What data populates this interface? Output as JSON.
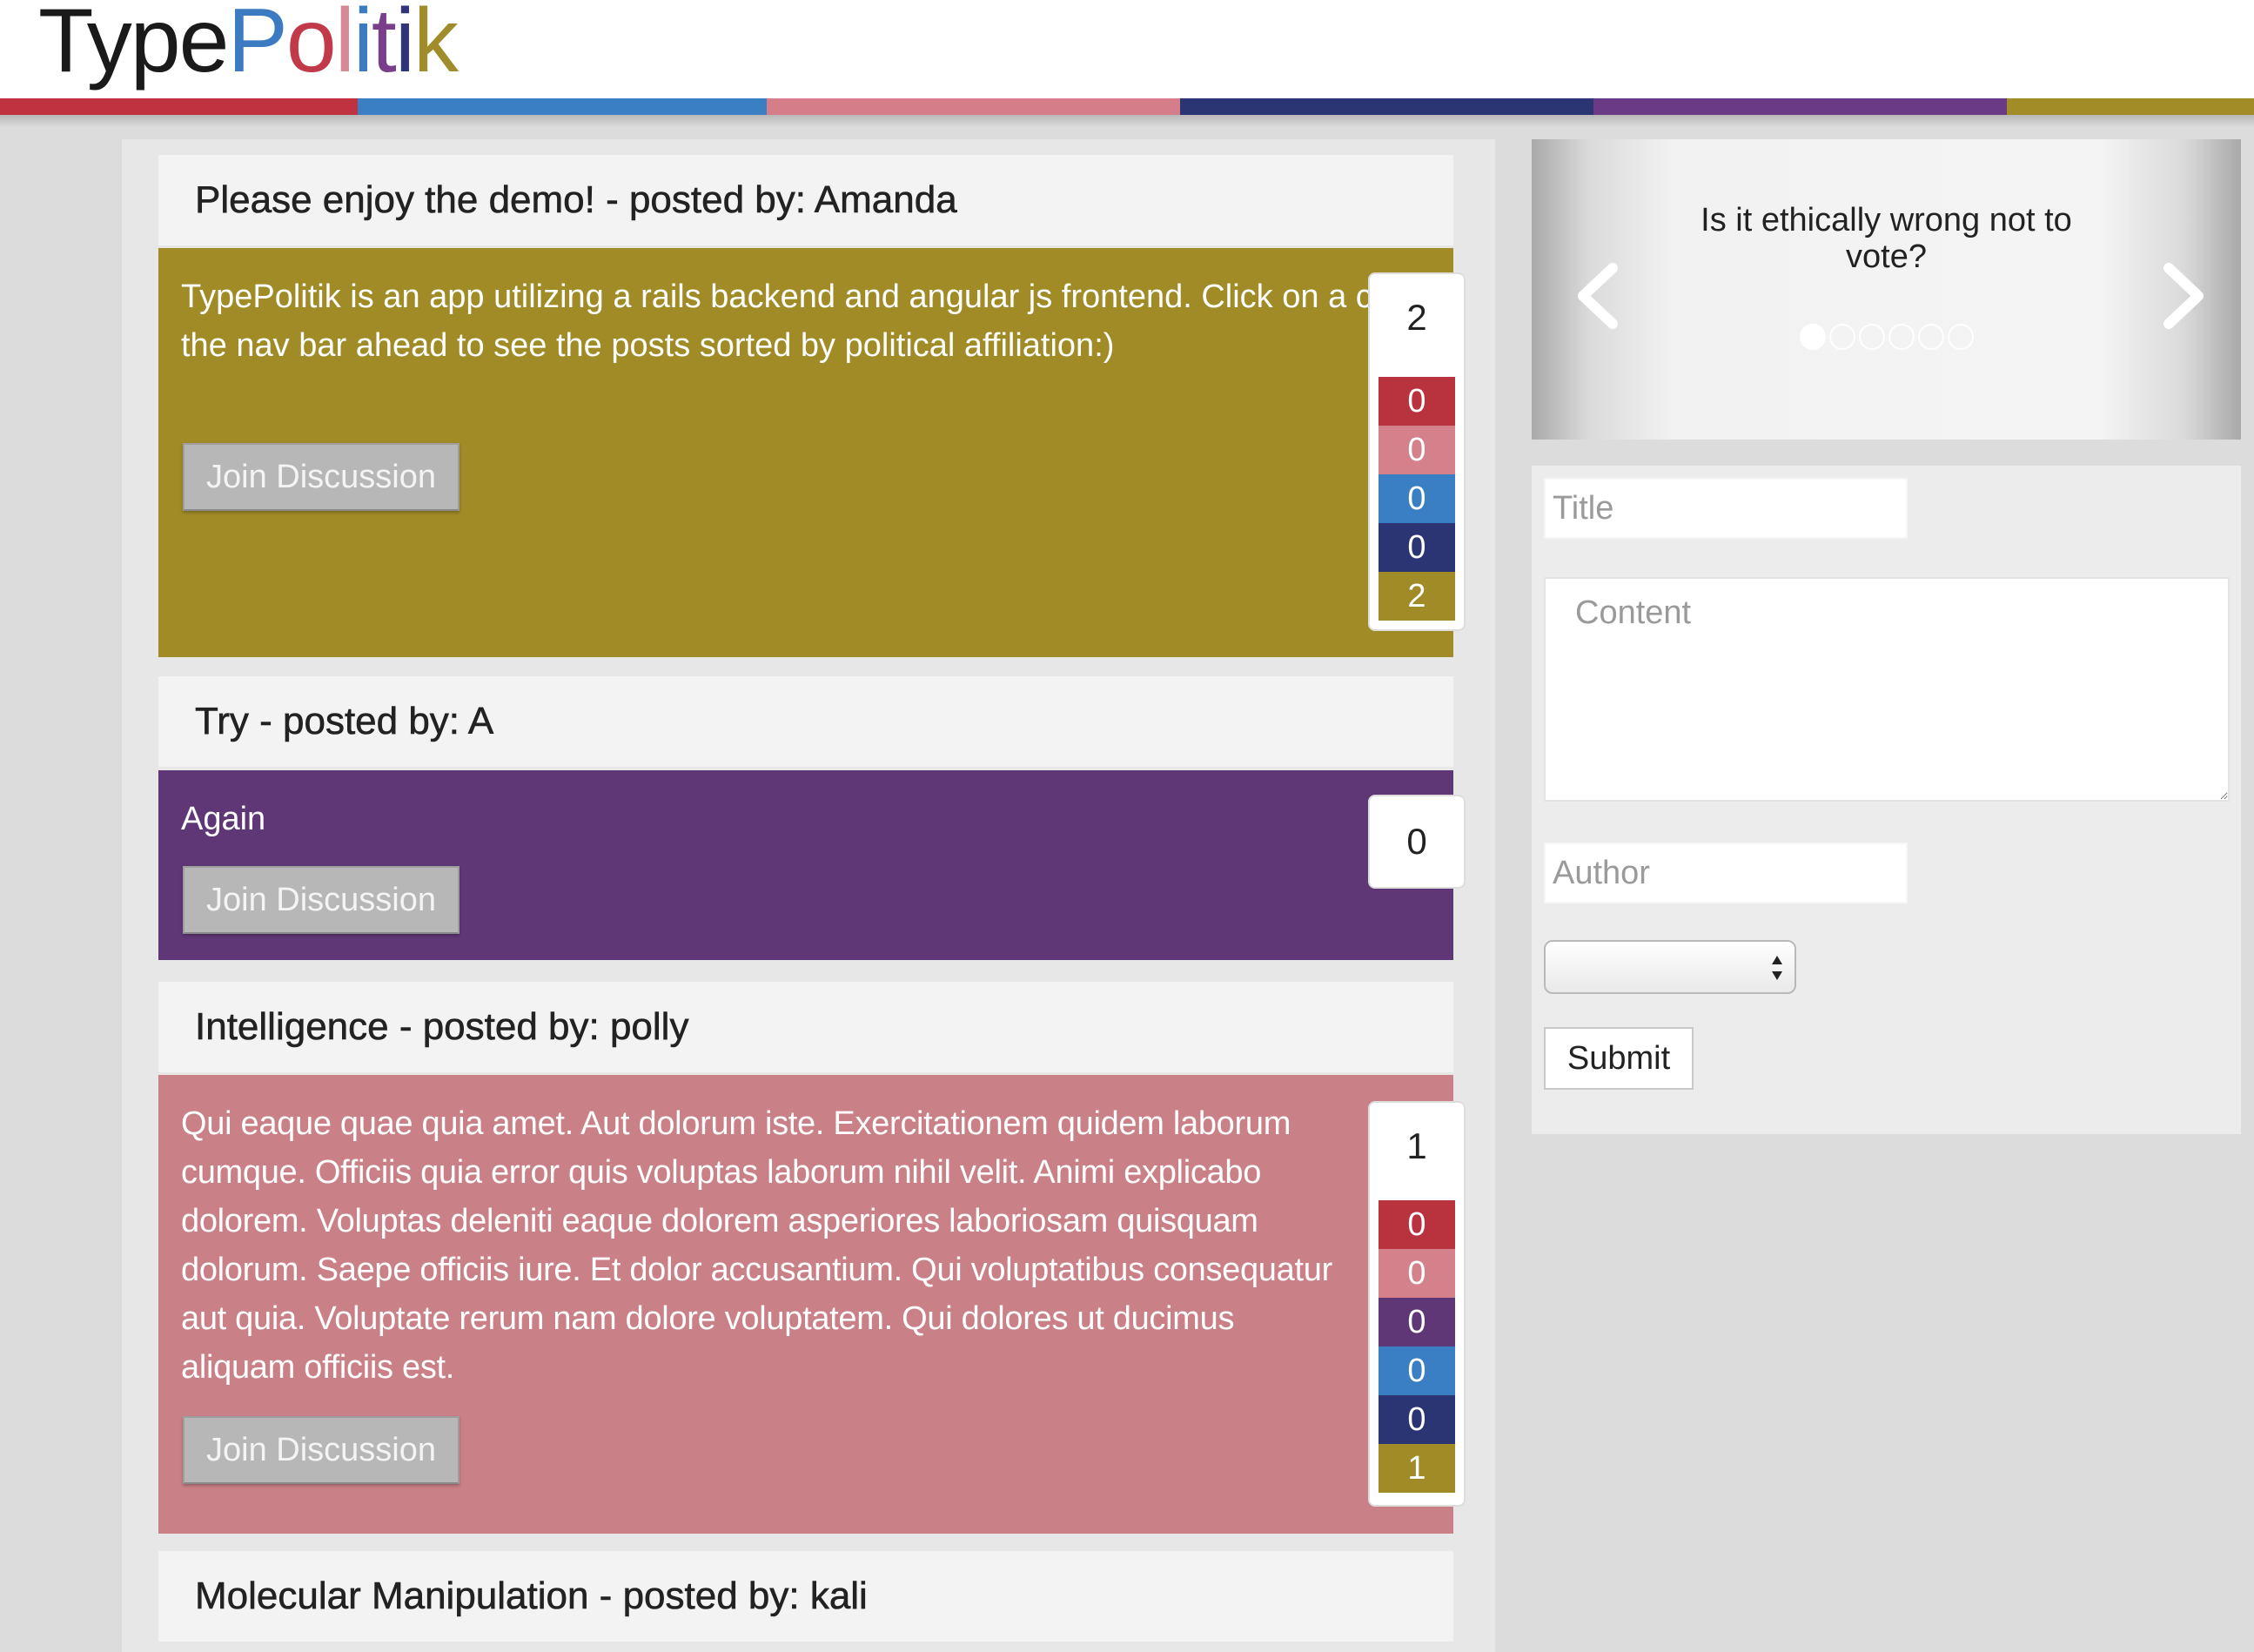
{
  "app": {
    "logo_letters": [
      {
        "ch": "T",
        "color": "#1a1a1a"
      },
      {
        "ch": "y",
        "color": "#1a1a1a"
      },
      {
        "ch": "p",
        "color": "#1a1a1a"
      },
      {
        "ch": "e",
        "color": "#1a1a1a"
      },
      {
        "ch": "P",
        "color": "#3c7bc2"
      },
      {
        "ch": "o",
        "color": "#c23a4a"
      },
      {
        "ch": "l",
        "color": "#d68a97"
      },
      {
        "ch": "i",
        "color": "#3c7bc2"
      },
      {
        "ch": "t",
        "color": "#7a3f8a"
      },
      {
        "ch": "i",
        "color": "#2f3578"
      },
      {
        "ch": "k",
        "color": "#a08c2a"
      }
    ]
  },
  "navbar": {
    "segments": [
      {
        "name": "red",
        "color": "#c0323f"
      },
      {
        "name": "blue",
        "color": "#3a7fc4"
      },
      {
        "name": "pink",
        "color": "#d57e89"
      },
      {
        "name": "navy",
        "color": "#2b3574"
      },
      {
        "name": "purple",
        "color": "#6a3a86"
      },
      {
        "name": "olive",
        "color": "#a18c27"
      }
    ]
  },
  "colors": {
    "red": "#b8333d",
    "pink": "#d4818b",
    "blue": "#3a7fc4",
    "navy": "#2c3574",
    "purple": "#5f3776",
    "olive": "#a08b27"
  },
  "posts": [
    {
      "heading": "Please enjoy the demo! - posted by: Amanda",
      "body": "TypePolitik is an app utilizing a rails backend and angular js frontend. Click on a color in the nav bar ahead to see the posts sorted by political affiliation:)",
      "color": "#a08b27",
      "button": "Join Discussion",
      "total": "2",
      "breakdown": [
        {
          "value": "0",
          "color": "#b8333d"
        },
        {
          "value": "0",
          "color": "#d4818b"
        },
        {
          "value": "0",
          "color": "#3a7fc4"
        },
        {
          "value": "0",
          "color": "#2c3574"
        },
        {
          "value": "2",
          "color": "#a08b27"
        }
      ]
    },
    {
      "heading": "Try - posted by: A",
      "body": "Again",
      "color": "#5f3776",
      "button": "Join Discussion",
      "total": "0",
      "breakdown": []
    },
    {
      "heading": "Intelligence - posted by: polly",
      "body": "Qui eaque quae quia amet. Aut dolorum iste. Exercitationem quidem laborum cumque. Officiis quia error quis voluptas laborum nihil velit. Animi explicabo dolorem. Voluptas deleniti eaque dolorem asperiores laboriosam quisquam dolorum. Saepe officiis iure. Et dolor accusantium. Qui voluptatibus consequatur aut quia. Voluptate rerum nam dolore voluptatem. Qui dolores ut ducimus aliquam officiis est.",
      "color": "#c98086",
      "button": "Join Discussion",
      "total": "1",
      "breakdown": [
        {
          "value": "0",
          "color": "#b8333d"
        },
        {
          "value": "0",
          "color": "#d4818b"
        },
        {
          "value": "0",
          "color": "#5f3776"
        },
        {
          "value": "0",
          "color": "#3a7fc4"
        },
        {
          "value": "0",
          "color": "#2c3574"
        },
        {
          "value": "1",
          "color": "#a08b27"
        }
      ]
    },
    {
      "heading": "Molecular Manipulation - posted by: kali"
    }
  ],
  "carousel": {
    "question": "Is it ethically wrong not to vote?",
    "prev_icon": "chevron-left-icon",
    "next_icon": "chevron-right-icon",
    "dot_count": 6,
    "active_dot": 0
  },
  "form": {
    "title_placeholder": "Title",
    "content_placeholder": "Content",
    "author_placeholder": "Author",
    "select_value": "",
    "submit_label": "Submit"
  }
}
